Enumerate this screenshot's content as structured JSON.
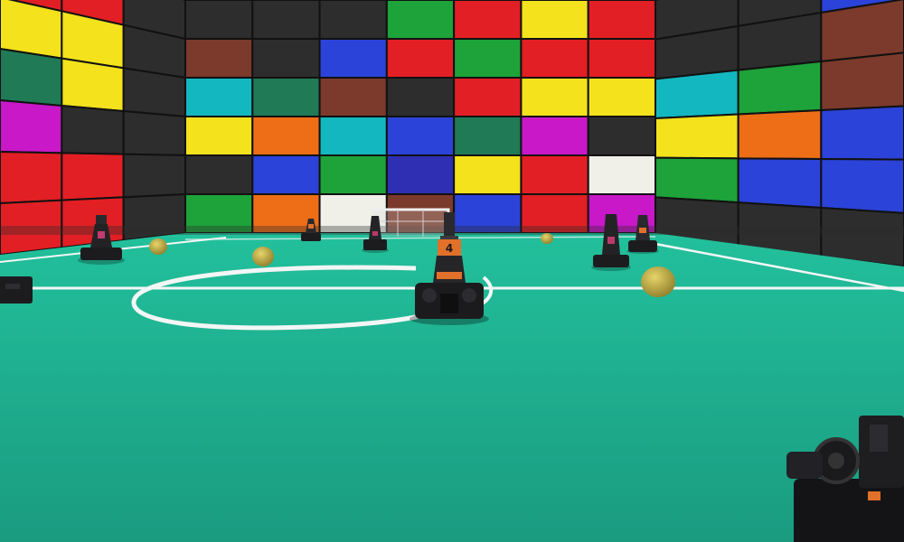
{
  "scene": {
    "type": "3d-robot-soccer-arena",
    "colors": {
      "floor": "#20b391",
      "floor_dark": "#189478",
      "line": "#f2f6f5",
      "goal": "#e8e8e8",
      "ball": "#c9b54a",
      "robot_body": "#1c1c1e",
      "robot_accent": "#e0702a"
    },
    "featured_robot_number": "4",
    "wall_tile_palette": [
      "#e21f24",
      "#f3e21c",
      "#c818c7",
      "#2b43d8",
      "#13b7c0",
      "#1ea23a",
      "#ee6d17",
      "#7b3a2b",
      "#2d2d2d",
      "#1f7a55",
      "#f0f0e8",
      "#2f2fb3"
    ]
  }
}
